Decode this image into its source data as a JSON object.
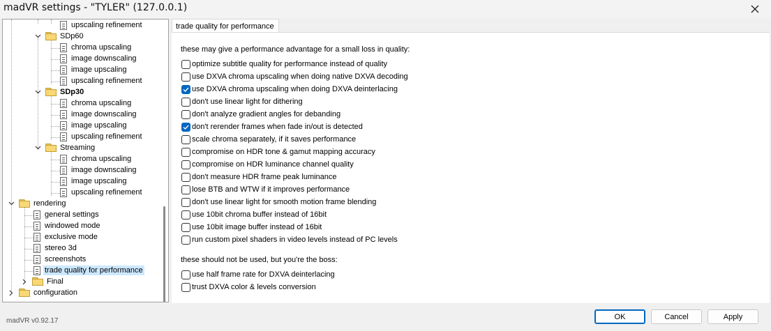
{
  "window": {
    "title": "madVR settings - \"TYLER\" (127.0.0.1)",
    "close_icon": "close-icon"
  },
  "tree": {
    "nodes": [
      "upscaling refinement",
      "SDp60",
      "chroma upscaling",
      "image downscaling",
      "image upscaling",
      "upscaling refinement",
      "SDp30",
      "chroma upscaling",
      "image downscaling",
      "image upscaling",
      "upscaling refinement",
      "Streaming",
      "chroma upscaling",
      "image downscaling",
      "image upscaling",
      "upscaling refinement",
      "rendering",
      "general settings",
      "windowed mode",
      "exclusive mode",
      "stereo 3d",
      "screenshots",
      "trade quality for performance",
      "Final",
      "configuration"
    ]
  },
  "tab_label": "trade quality for performance",
  "section1": "these may give a performance advantage for a small loss in quality:",
  "options": [
    {
      "label": "optimize subtitle quality for performance instead of quality",
      "checked": false
    },
    {
      "label": "use DXVA chroma upscaling when doing native DXVA decoding",
      "checked": false
    },
    {
      "label": "use DXVA chroma upscaling when doing DXVA deinterlacing",
      "checked": true
    },
    {
      "label": "don't use linear light for dithering",
      "checked": false
    },
    {
      "label": "don't analyze gradient angles for debanding",
      "checked": false
    },
    {
      "label": "don't rerender frames when fade in/out is detected",
      "checked": true
    },
    {
      "label": "scale chroma separately, if it saves performance",
      "checked": false
    },
    {
      "label": "compromise on HDR tone & gamut mapping accuracy",
      "checked": false
    },
    {
      "label": "compromise on HDR luminance channel quality",
      "checked": false
    },
    {
      "label": "don't measure HDR frame peak luminance",
      "checked": false
    },
    {
      "label": "lose BTB and WTW if it improves performance",
      "checked": false
    },
    {
      "label": "don't use linear light for smooth motion frame blending",
      "checked": false
    },
    {
      "label": "use 10bit chroma buffer instead of 16bit",
      "checked": false
    },
    {
      "label": "use 10bit image buffer instead of 16bit",
      "checked": false
    },
    {
      "label": "run custom pixel shaders in video levels instead of PC levels",
      "checked": false
    }
  ],
  "section2": "these should not be used, but you're the boss:",
  "options2": [
    {
      "label": "use half frame rate for DXVA deinterlacing",
      "checked": false
    },
    {
      "label": "trust DXVA color & levels conversion",
      "checked": false
    }
  ],
  "version": "madVR v0.92.17",
  "buttons": {
    "ok": "OK",
    "cancel": "Cancel",
    "apply": "Apply"
  },
  "colors": {
    "accent": "#0067c0",
    "selection": "#cce8ff"
  }
}
